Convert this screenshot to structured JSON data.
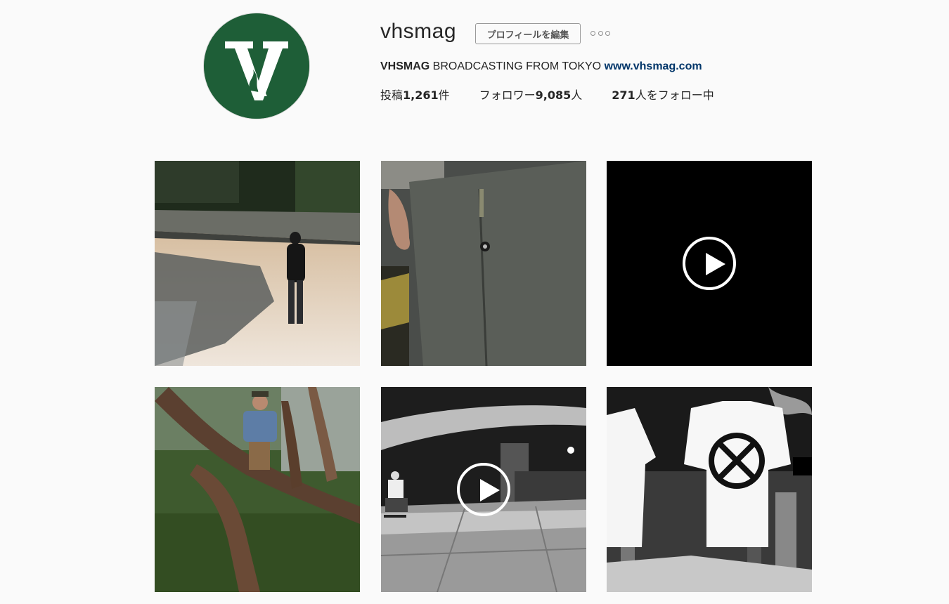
{
  "profile": {
    "username": "vhsmag",
    "edit_profile_label": "プロフィールを編集",
    "more_icon": "ellipsis-icon",
    "bio_name": "VHSMAG",
    "bio_text": " BROADCASTING FROM TOKYO ",
    "bio_link": "www.vhsmag.com",
    "avatar_letter": "V",
    "brand_color": "#1e5e37"
  },
  "stats": {
    "posts_prefix": "投稿",
    "posts_count": "1,261",
    "posts_suffix": "件",
    "followers_prefix": "フォロワー",
    "followers_count": "9,085",
    "followers_suffix": "人",
    "following_count": "271",
    "following_suffix": "人をフォロー中"
  },
  "posts": [
    {
      "kind": "photo",
      "subject": "skater walking on beach"
    },
    {
      "kind": "photo",
      "subject": "grey work pants close-up"
    },
    {
      "kind": "video",
      "subject": "black video frame"
    },
    {
      "kind": "photo",
      "subject": "man standing in pine tree"
    },
    {
      "kind": "video",
      "subject": "night skate fisheye"
    },
    {
      "kind": "photo",
      "subject": "white t-shirts with logo"
    }
  ]
}
